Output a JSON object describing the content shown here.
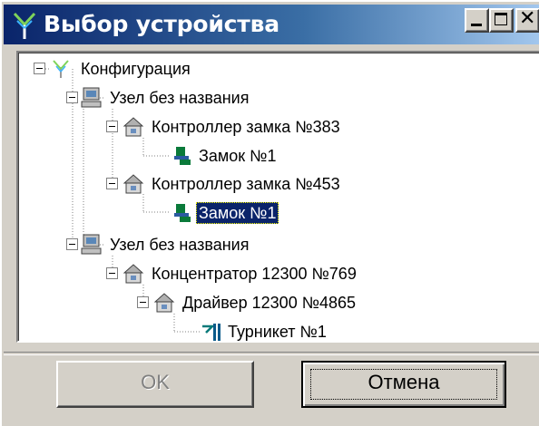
{
  "window": {
    "title": "Выбор устройства",
    "accent": "#0a246a",
    "controls": {
      "minimize": "minimize-icon",
      "maximize": "maximize-icon",
      "close": "close-icon",
      "close_glyph": "✕"
    }
  },
  "tree": {
    "nodes": [
      {
        "label": "Конфигурация",
        "icon": "configuration-icon"
      },
      {
        "label": "Узел без названия",
        "icon": "computer-icon"
      },
      {
        "label": "Контроллер замка №383",
        "icon": "controller-icon"
      },
      {
        "label": "Замок №1",
        "icon": "lock-icon"
      },
      {
        "label": "Контроллер замка №453",
        "icon": "controller-icon"
      },
      {
        "label": "Замок №1",
        "icon": "lock-icon",
        "selected": true
      },
      {
        "label": "Узел без названия",
        "icon": "computer-icon"
      },
      {
        "label": "Концентратор 12300 №769",
        "icon": "hub-icon"
      },
      {
        "label": "Драйвер 12300 №4865",
        "icon": "driver-icon"
      },
      {
        "label": "Турникет №1",
        "icon": "turnstile-icon"
      }
    ]
  },
  "buttons": {
    "ok": {
      "label": "OK",
      "enabled": false
    },
    "cancel": {
      "label": "Отмена",
      "enabled": true
    }
  }
}
